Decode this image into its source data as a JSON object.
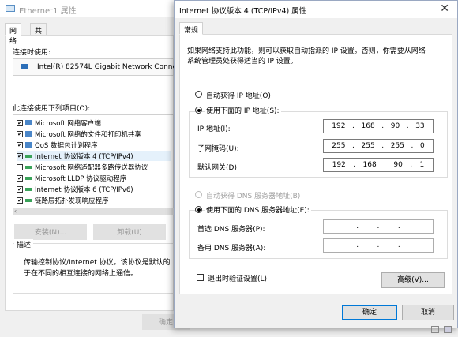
{
  "back_window": {
    "title": "Ethernet1 属性",
    "tabs": [
      "网络",
      "共享"
    ],
    "connect_using_label": "连接时使用:",
    "adapter_name": "Intel(R) 82574L Gigabit Network Conne",
    "items_label": "此连接使用下列项目(O):",
    "items": [
      {
        "label": "Microsoft 网络客户端",
        "checked": "✔",
        "icon": "blue"
      },
      {
        "label": "Microsoft 网络的文件和打印机共享",
        "checked": "✔",
        "icon": "blue"
      },
      {
        "label": "QoS 数据包计划程序",
        "checked": "✔",
        "icon": "blue"
      },
      {
        "label": "Internet 协议版本 4 (TCP/IPv4)",
        "checked": "✔",
        "icon": "green"
      },
      {
        "label": "Microsoft 网络适配器多路传送器协议",
        "checked": "",
        "icon": "green"
      },
      {
        "label": "Microsoft LLDP 协议驱动程序",
        "checked": "✔",
        "icon": "green"
      },
      {
        "label": "Internet 协议版本 6 (TCP/IPv6)",
        "checked": "✔",
        "icon": "green"
      },
      {
        "label": "链路层拓扑发现响应程序",
        "checked": "✔",
        "icon": "green"
      }
    ],
    "install_button": "安装(N)...",
    "uninstall_button": "卸载(U)",
    "description_title": "描述",
    "description_line1": "传输控制协议/Internet 协议。该协议是默认的",
    "description_line2": "于在不同的相互连接的网络上通信。",
    "ok_button": "确定"
  },
  "dialog": {
    "title": "Internet 协议版本 4 (TCP/IPv4) 属性",
    "close_glyph": "✕",
    "tab": "常规",
    "intro_line1": "如果网络支持此功能，则可以获取自动指派的 IP 设置。否则，你需要从网络",
    "intro_line2": "系统管理员处获得适当的 IP 设置。",
    "auto_ip_label": "自动获得 IP 地址(O)",
    "manual_ip_label": "使用下面的 IP 地址(S):",
    "ip_address_label": "IP 地址(I):",
    "ip_address": [
      "192",
      "168",
      "90",
      "33"
    ],
    "subnet_mask_label": "子网掩码(U):",
    "subnet_mask": [
      "255",
      "255",
      "255",
      "0"
    ],
    "gateway_label": "默认网关(D):",
    "gateway": [
      "192",
      "168",
      "90",
      "1"
    ],
    "auto_dns_label": "自动获得 DNS 服务器地址(B)",
    "manual_dns_label": "使用下面的 DNS 服务器地址(E):",
    "preferred_dns_label": "首选 DNS 服务器(P):",
    "alternate_dns_label": "备用 DNS 服务器(A):",
    "dot": ".",
    "validate_label": "退出时验证设置(L)",
    "advanced_button": "高级(V)...",
    "ok_button": "确定",
    "cancel_button": "取消"
  }
}
